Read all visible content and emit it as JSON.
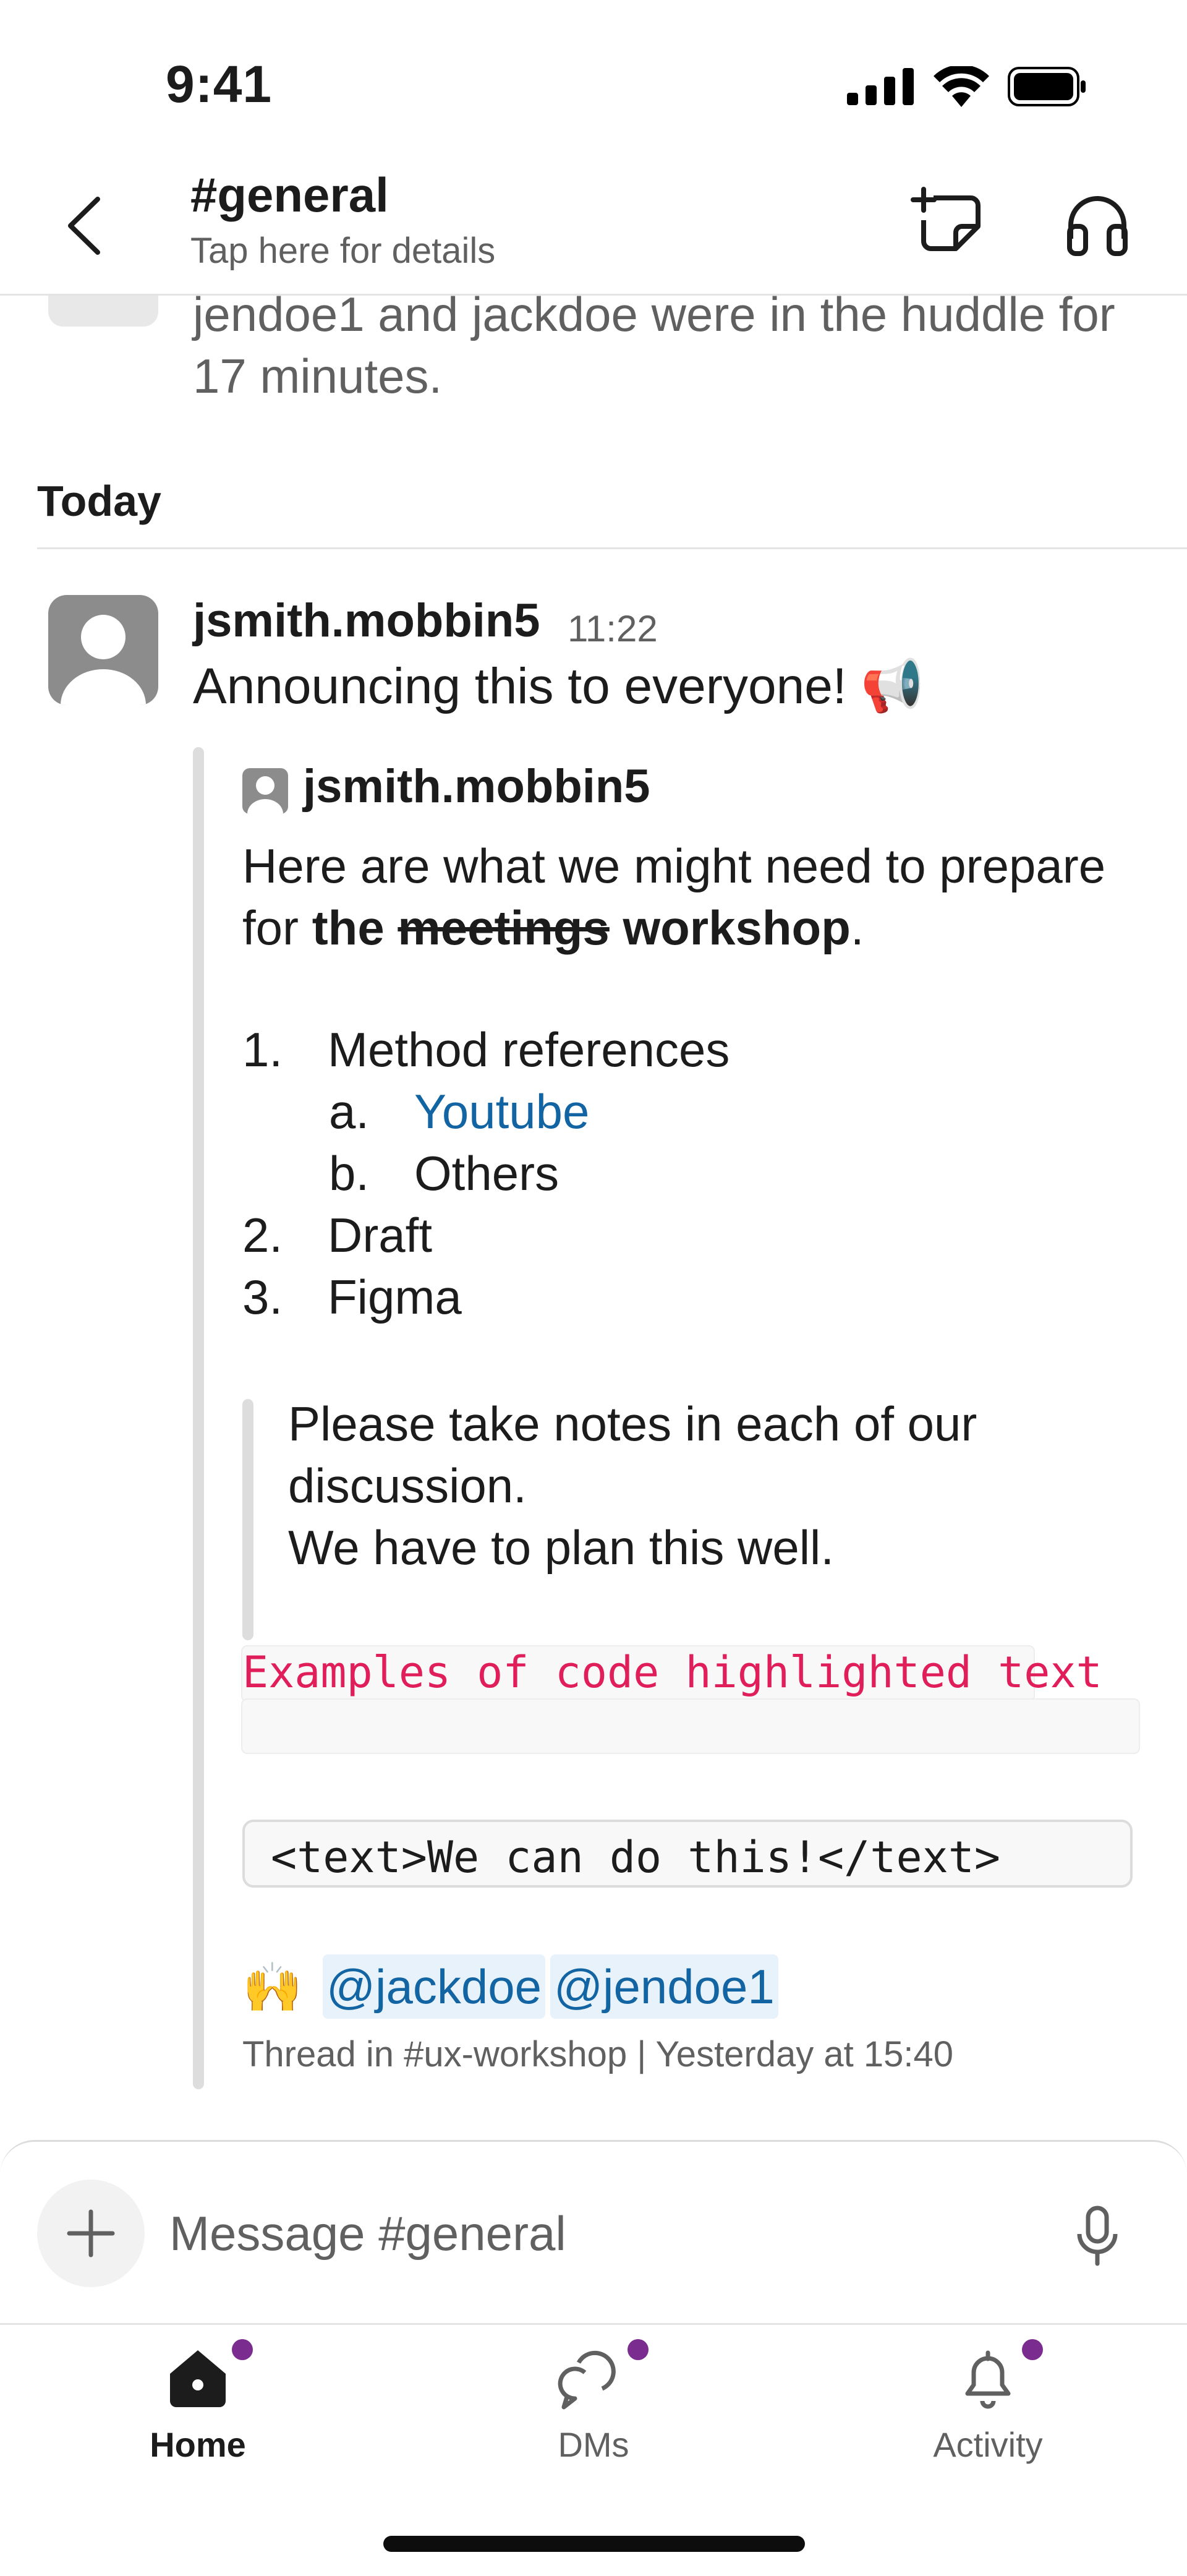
{
  "status_bar": {
    "time": "9:41"
  },
  "header": {
    "channel_name": "#general",
    "subtitle": "Tap here for details"
  },
  "feed": {
    "huddle_text": "jendoe1 and jackdoe were in the huddle for 17 minutes.",
    "date_divider": "Today",
    "message": {
      "author": "jsmith.mobbin5",
      "time": "11:22",
      "text": "Announcing this to everyone! 📢",
      "attachment": {
        "author": "jsmith.mobbin5",
        "intro_plain": "Here are what we might need to prepare for ",
        "intro_bold1": "the",
        "intro_strike": "meetings",
        "intro_bold2": "workshop",
        "intro_end": ".",
        "list": [
          {
            "marker": "1.",
            "text": "Method references"
          },
          {
            "marker": "a.",
            "text": "Youtube",
            "link": true
          },
          {
            "marker": "b.",
            "text": "Others"
          },
          {
            "marker": "2.",
            "text": "Draft"
          },
          {
            "marker": "3.",
            "text": "Figma"
          }
        ],
        "blockquote_line1": "Please take notes in each of our discussion.",
        "blockquote_line2": "We have to plan this well.",
        "inline_code": "Examples of code highlighted text",
        "code_block": "<text>We can do this!</text>",
        "emoji": "🙌",
        "mentions": [
          "@jackdoe",
          "@jendoe1"
        ],
        "footer": "Thread in #ux-workshop | Yesterday at 15:40"
      }
    }
  },
  "composer": {
    "placeholder": "Message #general"
  },
  "tabs": [
    {
      "label": "Home",
      "active": true
    },
    {
      "label": "DMs",
      "active": false
    },
    {
      "label": "Activity",
      "active": false
    }
  ],
  "colors": {
    "accent_dot": "#7b2c8f",
    "link": "#1264a3",
    "code": "#e01e5a"
  }
}
